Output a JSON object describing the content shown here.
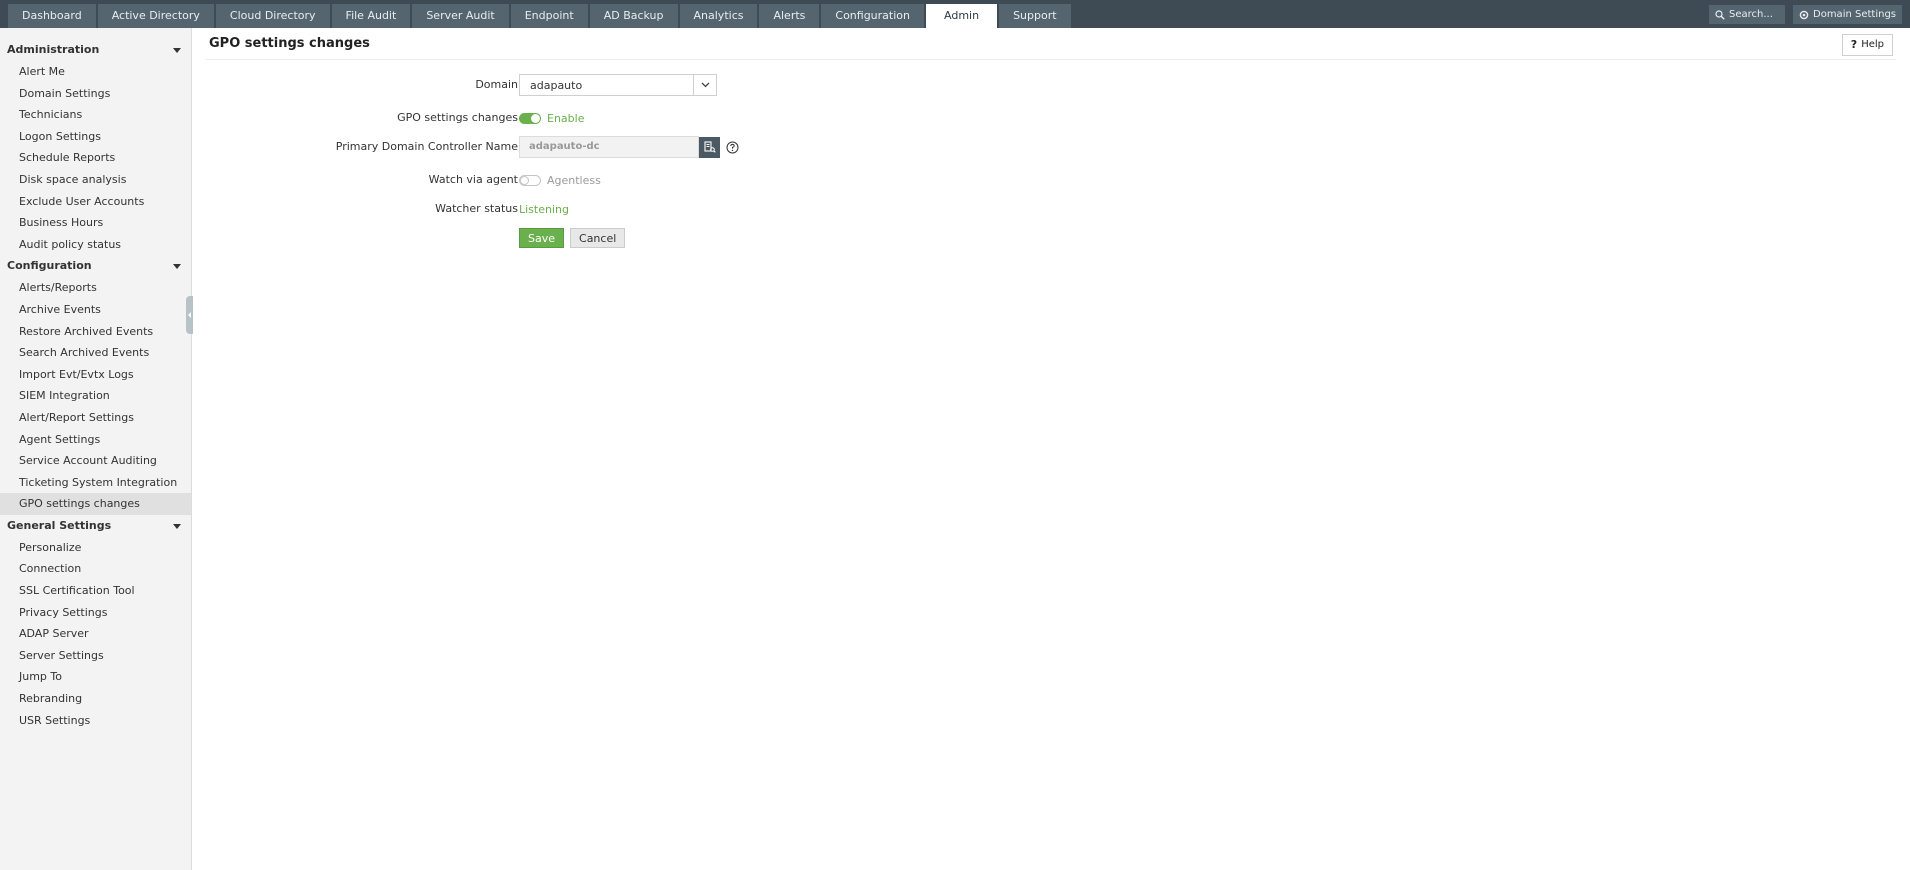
{
  "nav": {
    "tabs": [
      {
        "label": "Dashboard"
      },
      {
        "label": "Active Directory"
      },
      {
        "label": "Cloud Directory"
      },
      {
        "label": "File Audit"
      },
      {
        "label": "Server Audit"
      },
      {
        "label": "Endpoint"
      },
      {
        "label": "AD Backup"
      },
      {
        "label": "Analytics"
      },
      {
        "label": "Alerts"
      },
      {
        "label": "Configuration"
      },
      {
        "label": "Admin"
      },
      {
        "label": "Support"
      }
    ],
    "active_tab": "Admin",
    "search_placeholder": "Search...",
    "domain_settings_label": "Domain Settings"
  },
  "sidebar": {
    "sections": [
      {
        "title": "Administration",
        "items": [
          {
            "label": "Alert Me"
          },
          {
            "label": "Domain Settings"
          },
          {
            "label": "Technicians"
          },
          {
            "label": "Logon Settings"
          },
          {
            "label": "Schedule Reports"
          },
          {
            "label": "Disk space analysis"
          },
          {
            "label": "Exclude User Accounts"
          },
          {
            "label": "Business Hours"
          },
          {
            "label": "Audit policy status"
          }
        ]
      },
      {
        "title": "Configuration",
        "items": [
          {
            "label": "Alerts/Reports"
          },
          {
            "label": "Archive Events"
          },
          {
            "label": "Restore Archived Events"
          },
          {
            "label": "Search Archived Events"
          },
          {
            "label": "Import Evt/Evtx Logs"
          },
          {
            "label": "SIEM Integration"
          },
          {
            "label": "Alert/Report Settings"
          },
          {
            "label": "Agent Settings"
          },
          {
            "label": "Service Account Auditing"
          },
          {
            "label": "Ticketing System Integration"
          },
          {
            "label": "GPO settings changes"
          }
        ]
      },
      {
        "title": "General Settings",
        "items": [
          {
            "label": "Personalize"
          },
          {
            "label": "Connection"
          },
          {
            "label": "SSL Certification Tool"
          },
          {
            "label": "Privacy Settings"
          },
          {
            "label": "ADAP Server"
          },
          {
            "label": "Server Settings"
          },
          {
            "label": "Jump To"
          },
          {
            "label": "Rebranding"
          },
          {
            "label": "USR Settings"
          }
        ]
      }
    ],
    "active_item": "GPO settings changes"
  },
  "main": {
    "title": "GPO settings changes",
    "help_label": "Help",
    "form": {
      "domain_label": "Domain",
      "domain_value": "adapauto",
      "gpo_label": "GPO settings changes",
      "gpo_toggle_on": true,
      "gpo_toggle_text": "Enable",
      "pdc_label": "Primary Domain Controller Name",
      "pdc_value": "adapauto-dc",
      "watch_label": "Watch via agent",
      "watch_toggle_on": false,
      "watch_toggle_text": "Agentless",
      "watcher_status_label": "Watcher status",
      "watcher_status_value": "Listening",
      "save_label": "Save",
      "cancel_label": "Cancel"
    }
  },
  "colors": {
    "topbar_bg": "#3e4b55",
    "tab_bg": "#55656f",
    "accent_green": "#6ab04c",
    "sidebar_bg": "#f3f3f3",
    "sidebar_active_bg": "#e0e0e0"
  },
  "icons": {
    "search": "search-icon",
    "gear": "gear-icon",
    "dropdown": "chevron-down-icon",
    "picker": "server-picker-icon",
    "info": "help-circle-icon",
    "section_caret": "caret-down-icon"
  }
}
